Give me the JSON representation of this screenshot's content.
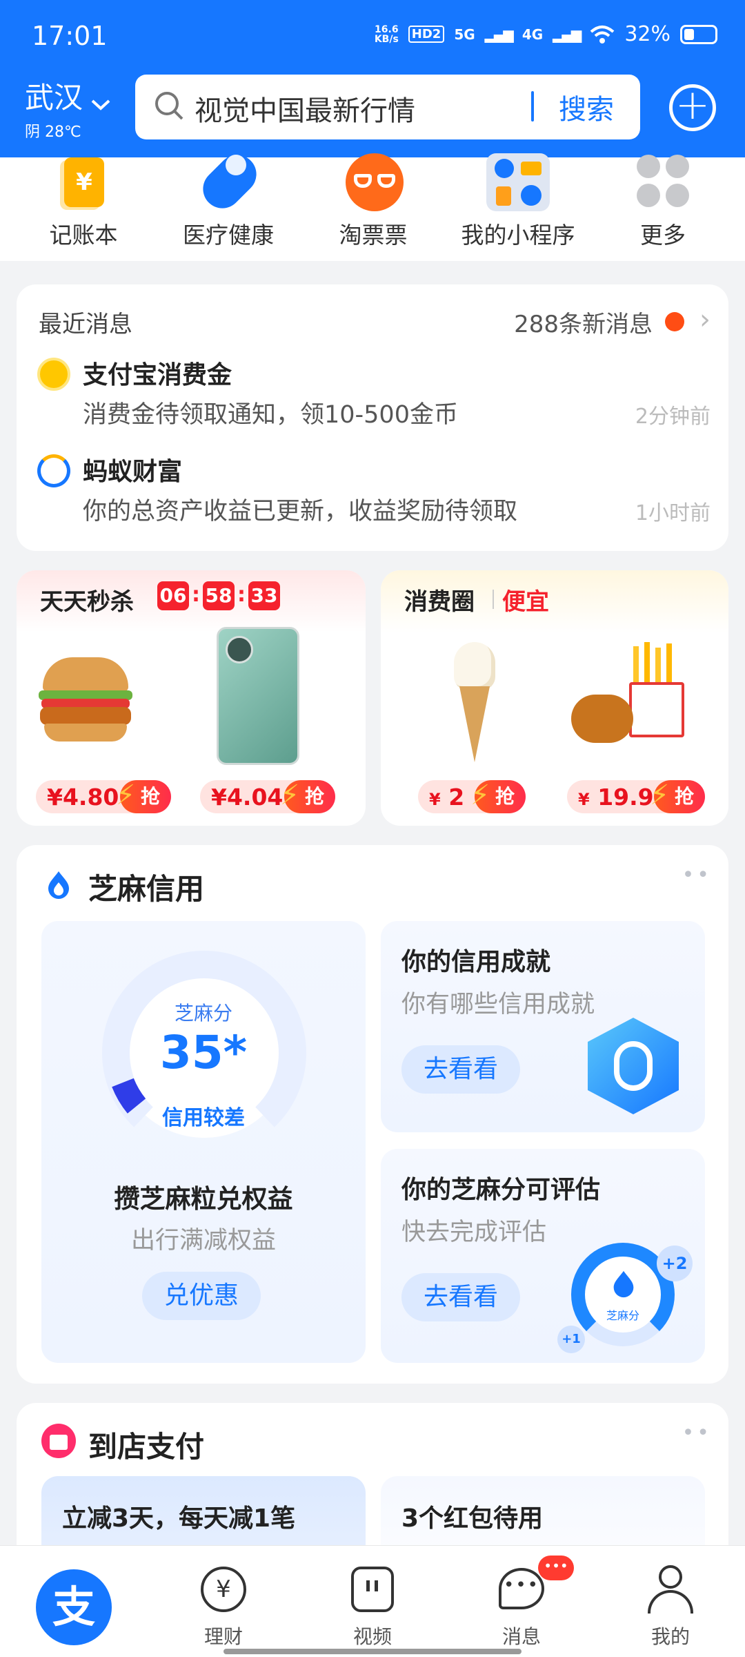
{
  "status": {
    "time": "17:01",
    "net_speed": "16.6\nKB/s",
    "hd": "HD2",
    "sig1": "5G",
    "sig2": "4G",
    "battery": "32%"
  },
  "header": {
    "city": "武汉",
    "weather": "阴 28℃",
    "search_placeholder": "视觉中国最新行情",
    "search_button": "搜索"
  },
  "shortcuts": [
    {
      "label": "记账本",
      "icon": "ledger-icon"
    },
    {
      "label": "医疗健康",
      "icon": "medical-icon"
    },
    {
      "label": "淘票票",
      "icon": "movie-ticket-icon"
    },
    {
      "label": "我的小程序",
      "icon": "mini-program-icon"
    },
    {
      "label": "更多",
      "icon": "more-grid-icon"
    }
  ],
  "messages": {
    "title": "最近消息",
    "count": "288条新消息",
    "items": [
      {
        "name": "支付宝消费金",
        "text": "消费金待领取通知，领10-500金币",
        "time": "2分钟前"
      },
      {
        "name": "蚂蚁财富",
        "text": "你的总资产收益已更新，收益奖励待领取",
        "time": "1小时前"
      }
    ]
  },
  "flash_sale": {
    "title": "天天秒杀",
    "timer": [
      "06",
      "58",
      "33"
    ],
    "items": [
      {
        "price": "¥4.80",
        "grab": "抢"
      },
      {
        "price": "¥4.04",
        "grab": "抢"
      }
    ]
  },
  "consume": {
    "title": "消费圈",
    "subtitle": "便宜",
    "items": [
      {
        "currency": "¥",
        "price": "2",
        "grab": "抢"
      },
      {
        "currency": "¥",
        "price": "19.9",
        "grab": "抢"
      }
    ]
  },
  "sesame": {
    "title": "芝麻信用",
    "score_label": "芝麻分",
    "score": "35*",
    "rating": "信用较差",
    "earn_title": "攒芝麻粒兑权益",
    "earn_sub": "出行满减权益",
    "earn_btn": "兑优惠",
    "achieve_title": "你的信用成就",
    "achieve_sub": "你有哪些信用成就",
    "achieve_btn": "去看看",
    "assess_title": "你的芝麻分可评估",
    "assess_sub": "快去完成评估",
    "assess_btn": "去看看",
    "badge_plus1": "+1",
    "badge_plus2": "+2",
    "badge_label": "芝麻分"
  },
  "store_pay": {
    "title": "到店支付",
    "left_text": "立减3天，每天减1笔",
    "right_text": "3个红包待用"
  },
  "tabs": [
    {
      "label": "理财"
    },
    {
      "label": "视频"
    },
    {
      "label": "消息"
    },
    {
      "label": "我的"
    }
  ],
  "home_tab_glyph": "支",
  "colors": {
    "brand": "#1677ff",
    "red": "#f5222d"
  }
}
